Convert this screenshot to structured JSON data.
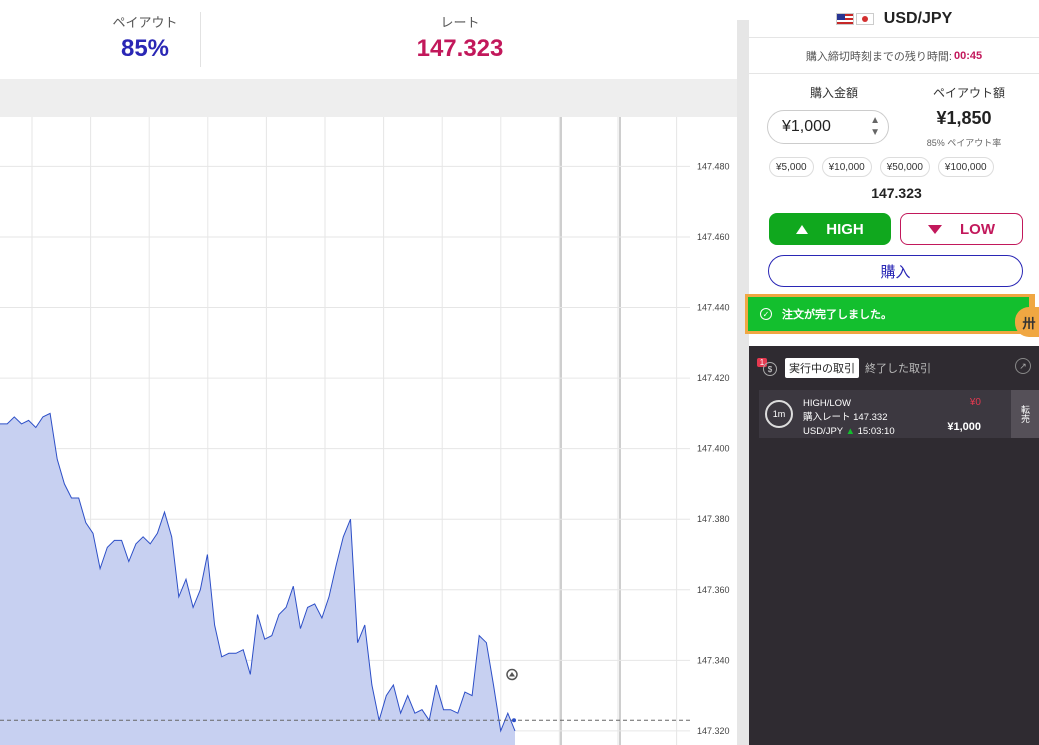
{
  "header": {
    "payout_label": "ペイアウト",
    "payout_value": "85%",
    "rate_label": "レート",
    "rate_value": "147.323"
  },
  "chart_data": {
    "type": "area",
    "ylim": [
      147.316,
      147.494
    ],
    "y_ticks": [
      "147.480",
      "147.460",
      "147.440",
      "147.420",
      "147.400",
      "147.380",
      "147.360",
      "147.340",
      "147.320"
    ],
    "current_rate": 147.323,
    "series": [
      {
        "values": [
          147.407,
          147.407,
          147.409,
          147.407,
          147.408,
          147.406,
          147.409,
          147.41,
          147.397,
          147.39,
          147.386,
          147.386,
          147.379,
          147.376,
          147.366,
          147.372,
          147.374,
          147.374,
          147.368,
          147.373,
          147.375,
          147.373,
          147.376,
          147.382,
          147.375,
          147.358,
          147.363,
          147.355,
          147.36,
          147.37,
          147.35,
          147.341,
          147.342,
          147.342,
          147.343,
          147.336,
          147.353,
          147.346,
          147.347,
          147.353,
          147.355,
          147.361,
          147.349,
          147.355,
          147.356,
          147.352,
          147.358,
          147.367,
          147.375,
          147.38,
          147.345,
          147.35,
          147.333,
          147.323,
          147.33,
          147.333,
          147.325,
          147.33,
          147.325,
          147.326,
          147.323,
          147.333,
          147.326,
          147.326,
          147.325,
          147.331,
          147.33,
          147.347,
          147.345,
          147.333,
          147.32,
          147.325,
          147.32
        ]
      }
    ]
  },
  "panel": {
    "pair": "USD/JPY",
    "deadline_label": "購入締切時刻までの残り時間:",
    "deadline_time": "00:45",
    "amount_label": "購入金額",
    "payout_label": "ペイアウト額",
    "amount_value": "¥1,000",
    "payout_amount": "¥1,850",
    "payout_rate": "85% ペイアウト率",
    "presets": [
      "¥5,000",
      "¥10,000",
      "¥50,000",
      "¥100,000"
    ],
    "current_rate": "147.323",
    "high_label": "HIGH",
    "low_label": "LOW",
    "buy_label": "購入",
    "toast": "注文が完了しました。",
    "side_tab": "卅"
  },
  "trades": {
    "badge_count": "1",
    "badge_coin": "$",
    "tab_active": "実行中の取引",
    "tab_done": "終了した取引",
    "card": {
      "timer": "1m",
      "type": "HIGH/LOW",
      "rate_line": "購入レート 147.332",
      "pair": "USD/JPY",
      "time": "15:03:10",
      "payout": "¥0",
      "amount": "¥1,000",
      "sell_label": "転売"
    }
  },
  "colors": {
    "accent_blue": "#2a27b5",
    "accent_red": "#c2185b",
    "high_green": "#10a81e",
    "area_fill": "#c7d0f1",
    "line": "#2d4fc7",
    "toast_border": "#f0a742"
  }
}
